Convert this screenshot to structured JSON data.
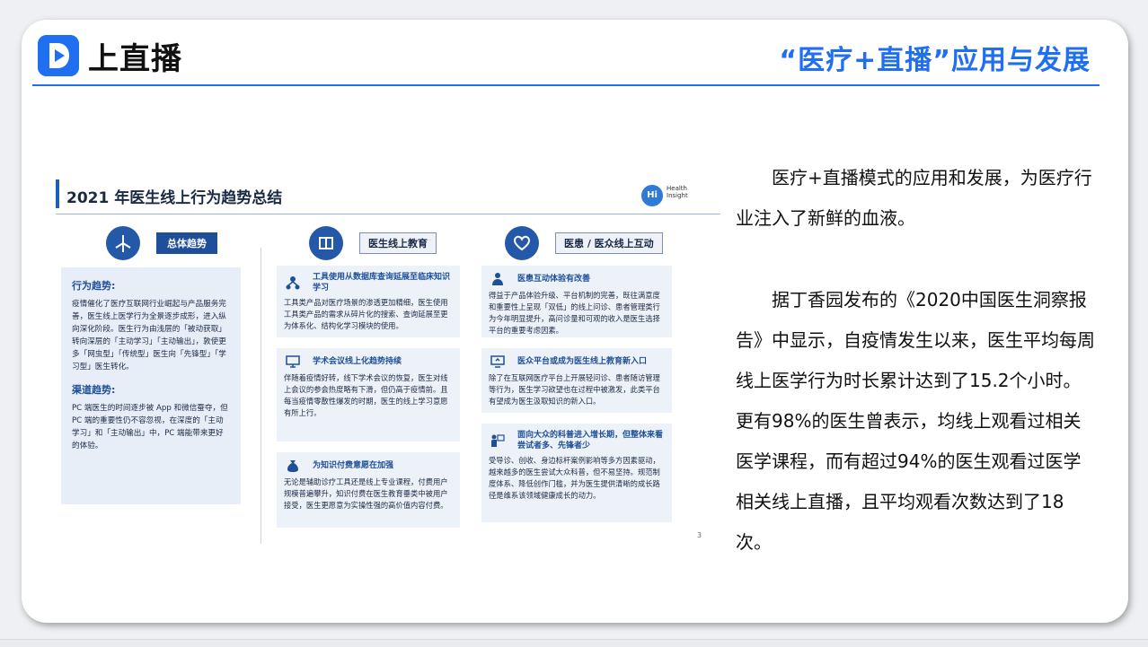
{
  "header": {
    "logo_text": "上直播",
    "page_title": "“医疗+直播”应用与发展"
  },
  "report": {
    "title": "2021 年医生线上行为趋势总结",
    "brand_lines": [
      "Health",
      "Insight"
    ],
    "brand_circle": "Hi",
    "page_number": "3",
    "columns": [
      {
        "tag": "总体趋势",
        "icon": "windmill-icon"
      },
      {
        "tag": "医生线上教育",
        "icon": "education-icon"
      },
      {
        "tag": "医患 / 医众线上互动",
        "icon": "heart-chat-icon"
      }
    ],
    "left_panel": {
      "sections": [
        {
          "heading": "行为趋势:",
          "body": "疫情催化了医疗互联网行业崛起与产品服务完善，医生线上医学行为全景逐步成形，进入纵向深化阶段。医生行为由浅层的「被动获取」转向深层的「主动学习」「主动输出」，敦使更多「网虫型」「传统型」医生向「先锋型」「学习型」医生转化。"
        },
        {
          "heading": "渠道趋势:",
          "body": "PC 端医生的时间逐步被 App 和微信蚕夺，但 PC 端的重要性仍不容忽视，在深度的「主动学习」和「主动输出」中，PC 端能带来更好的体验。"
        }
      ]
    },
    "middle_cards": [
      {
        "icon": "network-icon",
        "title": "工具使用从数据库查询延展至临床知识学习",
        "body": "工具类产品对医疗场景的渗透更加精细，医生使用工具类产品的需求从碎片化的搜索、查询延展至更为体系化、结构化学习模块的使用。"
      },
      {
        "icon": "presentation-icon",
        "title": "学术会议线上化趋势持续",
        "body": "伴随着疫情好转，线下学术会议的恢复，医生对线上会议的参会热度略有下滑，但仍高于疫情前。且每当疫情零散性爆发的时期，医生的线上学习意愿有所上行。"
      },
      {
        "icon": "money-bag-icon",
        "title": "为知识付费意愿在加强",
        "body": "无论是辅助诊疗工具还是线上专业课程，付费用户规模普遍攀升，知识付费在医生教育垂类中被用户接受，医生更愿意为实操性强的高价值内容付费。"
      }
    ],
    "right_cards": [
      {
        "icon": "doctor-icon",
        "title": "医患互动体验有改善",
        "body": "得益于产品体验升级、平台机制的完善，既往满意度和重要性上呈现「双低」的线上问诊、患者管理类行为今年明显提升，高问诊量和可观的收入是医生选择平台的重要考虑因素。"
      },
      {
        "icon": "screen-icon",
        "title": "医众平台或成为医生线上教育新入口",
        "body": "除了在互联网医疗平台上开展轻问诊、患者随访管理等行为，医生学习欲望也在过程中被激发，此类平台有望成为医生汲取知识的新入口。"
      },
      {
        "icon": "lecturer-icon",
        "title": "面向大众的科普进入增长期，但整体来看尝试者多、先锋者少",
        "body": "受导诊、创收、身边标杆案例影响等多方因素驱动，越来越多的医生尝试大众科普，但不易坚持。规范制度体系、降低创作门槛，并为医生提供清晰的成长路径是维系该领域健康成长的动力。"
      }
    ]
  },
  "body": {
    "paragraph1": "医疗+直播模式的应用和发展，为医疗行业注入了新鲜的血液。",
    "paragraph2": "据丁香园发布的《2020中国医生洞察报告》中显示，自疫情发生以来，医生平均每周线上医学行为时长累计达到了15.2个小时。更有98%的医生曾表示，均线上观看过相关医学课程，而有超过94%的医生观看过医学相关线上直播，且平均观看次数达到了18次。"
  },
  "colors": {
    "accent": "#1f6ff0",
    "report_navy": "#1f4f99",
    "panel_bg": "#e7eef8"
  }
}
